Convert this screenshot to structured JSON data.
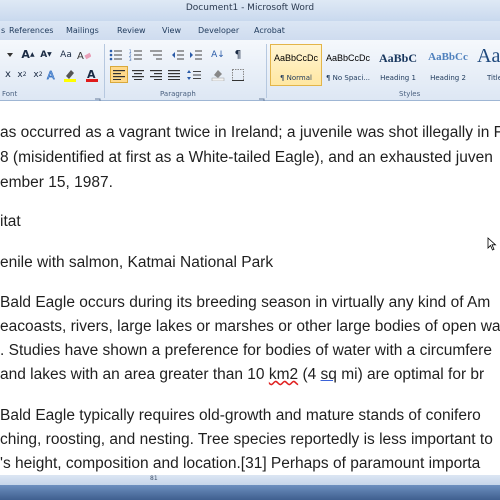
{
  "window": {
    "title": "Document1 - Microsoft Word"
  },
  "tabs": [
    "s",
    "References",
    "Mailings",
    "Review",
    "View",
    "Developer",
    "Acrobat"
  ],
  "ribbon": {
    "font_label": "Font",
    "paragraph_label": "Paragraph",
    "styles_label": "Styles",
    "styles": [
      {
        "sample": "AaBbCcDc",
        "name": "¶ Normal"
      },
      {
        "sample": "AaBbCcDc",
        "name": "¶ No Spaci..."
      },
      {
        "sample": "AaBbC",
        "name": "Heading 1"
      },
      {
        "sample": "AaBbCc",
        "name": "Heading 2"
      },
      {
        "sample": "Aa",
        "name": "Title"
      }
    ]
  },
  "document": {
    "lines": [
      {
        "segments": [
          {
            "text": "as occurred as a vagrant twice in Ireland; a juvenile was shot illegally in F"
          }
        ]
      },
      {
        "segments": [
          {
            "text": "8 (misidentified at first as a White-tailed Eagle), and an exhausted juven"
          }
        ]
      },
      {
        "segments": [
          {
            "text": "ember 15, 1987."
          }
        ]
      },
      {
        "segments": [
          {
            "text": "itat"
          }
        ]
      },
      {
        "segments": [
          {
            "text": "enile with salmon, Katmai National Park"
          }
        ]
      },
      {
        "segments": [
          {
            "text": "Bald Eagle occurs during its breeding season in virtually any kind of Am"
          }
        ]
      },
      {
        "segments": [
          {
            "text": "eacoasts, rivers, large lakes or marshes or other large bodies of open wa"
          }
        ]
      },
      {
        "segments": [
          {
            "text": ". Studies have shown a preference for bodies of water with a circumfere"
          }
        ]
      },
      {
        "segments": [
          {
            "text": "and lakes with an area greater than 10 "
          },
          {
            "text": "km2",
            "style": "spell"
          },
          {
            "text": " (4 "
          },
          {
            "text": "sq",
            "style": "grammar"
          },
          {
            "text": " mi) are optimal for br"
          }
        ]
      },
      {
        "segments": [
          {
            "text": "Bald Eagle typically requires old-growth and mature stands of conifero"
          }
        ]
      },
      {
        "segments": [
          {
            "text": "ching, roosting, and nesting. Tree species reportedly is less important to"
          }
        ]
      },
      {
        "segments": [
          {
            "text": "'s height, composition and location.[31] Perhaps of paramount importa"
          }
        ]
      }
    ]
  },
  "statusbar": {
    "text": "81"
  },
  "colors": {
    "ribbon_top": "#f5f8fc",
    "ribbon_bottom": "#dde7f4",
    "tab_text": "#1e395b",
    "selected_style": "#ffe7a2",
    "heading_blue": "#17365d",
    "title_blue": "#1f497d",
    "taskbar": "#3f5f8f"
  }
}
